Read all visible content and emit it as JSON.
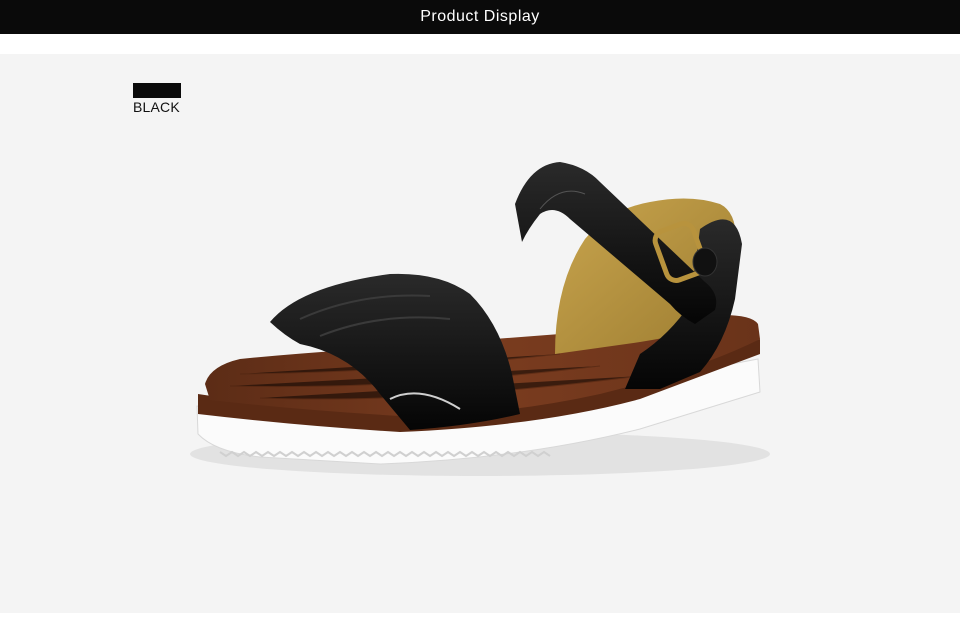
{
  "header": {
    "title": "Product Display"
  },
  "product": {
    "color_label": "BLACK"
  },
  "colors": {
    "header_bg": "#0a0a0a",
    "stage_bg": "#f4f4f4",
    "swatch": "#0a0a0a"
  },
  "image": {
    "subject": "sandal-photo"
  }
}
